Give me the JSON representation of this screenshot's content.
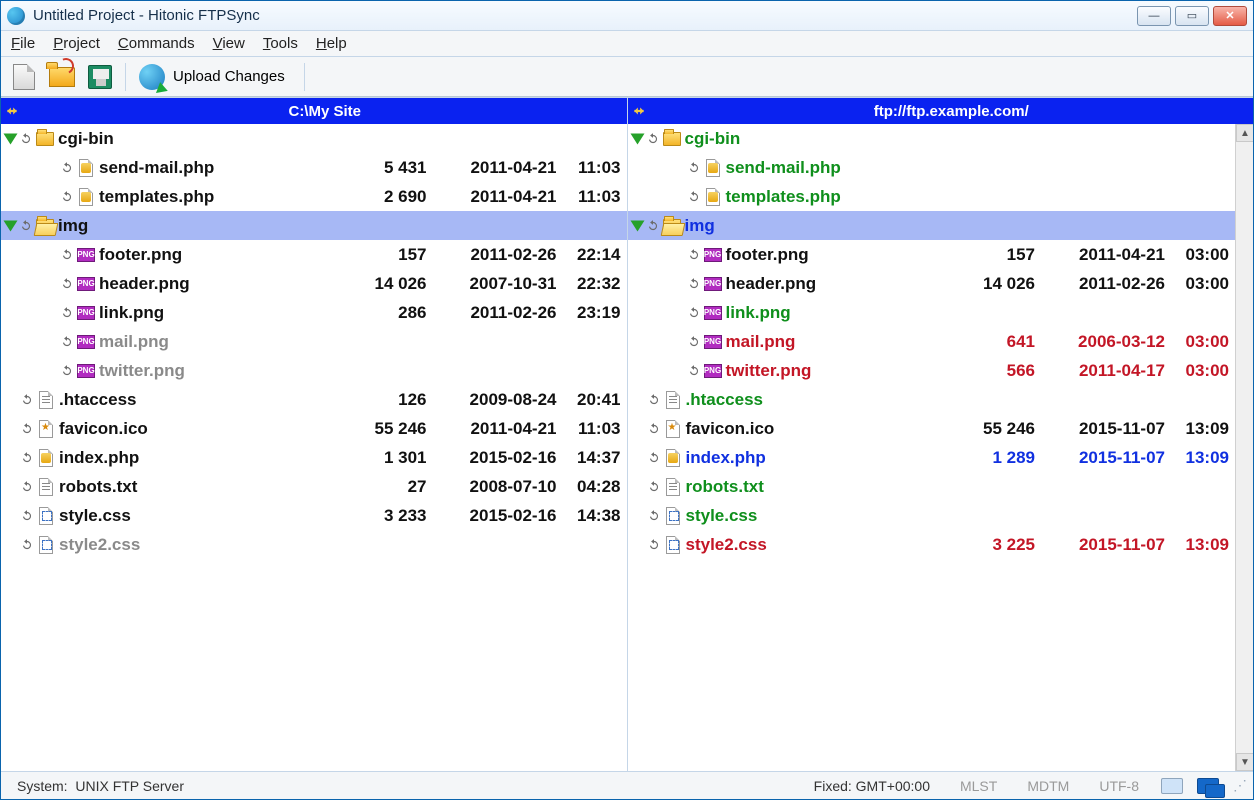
{
  "title": "Untitled Project - Hitonic FTPSync",
  "menu": [
    "File",
    "Project",
    "Commands",
    "View",
    "Tools",
    "Help"
  ],
  "toolbar": {
    "upload": "Upload Changes"
  },
  "left": {
    "path": "C:\\My Site",
    "rows": [
      {
        "type": "dir",
        "depth": 0,
        "expanded": true,
        "icon": "folder",
        "name": "cgi-bin",
        "dir": "<DIR>",
        "color": "black",
        "open": false
      },
      {
        "type": "file",
        "depth": 1,
        "icon": "php",
        "name": "send-mail.php",
        "size": "5 431",
        "date": "2011-04-21",
        "time": "11:03",
        "color": "black"
      },
      {
        "type": "file",
        "depth": 1,
        "icon": "php",
        "name": "templates.php",
        "size": "2 690",
        "date": "2011-04-21",
        "time": "11:03",
        "color": "black"
      },
      {
        "type": "dir",
        "depth": 0,
        "expanded": true,
        "icon": "folder-open",
        "name": "img",
        "dir": "<DIR>",
        "color": "black",
        "open": true,
        "selected": true
      },
      {
        "type": "file",
        "depth": 1,
        "icon": "png",
        "name": "footer.png",
        "size": "157",
        "date": "2011-02-26",
        "time": "22:14",
        "color": "black"
      },
      {
        "type": "file",
        "depth": 1,
        "icon": "png",
        "name": "header.png",
        "size": "14 026",
        "date": "2007-10-31",
        "time": "22:32",
        "color": "black"
      },
      {
        "type": "file",
        "depth": 1,
        "icon": "png",
        "name": "link.png",
        "size": "286",
        "date": "2011-02-26",
        "time": "23:19",
        "color": "black"
      },
      {
        "type": "file",
        "depth": 1,
        "icon": "png",
        "name": "mail.png",
        "size": "",
        "date": "",
        "time": "",
        "color": "gray"
      },
      {
        "type": "file",
        "depth": 1,
        "icon": "png",
        "name": "twitter.png",
        "size": "",
        "date": "",
        "time": "",
        "color": "gray"
      },
      {
        "type": "file",
        "depth": 0,
        "icon": "txt",
        "name": ".htaccess",
        "size": "126",
        "date": "2009-08-24",
        "time": "20:41",
        "color": "black"
      },
      {
        "type": "file",
        "depth": 0,
        "icon": "ico",
        "name": "favicon.ico",
        "size": "55 246",
        "date": "2011-04-21",
        "time": "11:03",
        "color": "black"
      },
      {
        "type": "file",
        "depth": 0,
        "icon": "php",
        "name": "index.php",
        "size": "1 301",
        "date": "2015-02-16",
        "time": "14:37",
        "color": "black"
      },
      {
        "type": "file",
        "depth": 0,
        "icon": "txt",
        "name": "robots.txt",
        "size": "27",
        "date": "2008-07-10",
        "time": "04:28",
        "color": "black"
      },
      {
        "type": "file",
        "depth": 0,
        "icon": "css",
        "name": "style.css",
        "size": "3 233",
        "date": "2015-02-16",
        "time": "14:38",
        "color": "black"
      },
      {
        "type": "file",
        "depth": 0,
        "icon": "css",
        "name": "style2.css",
        "size": "",
        "date": "",
        "time": "",
        "color": "gray"
      }
    ]
  },
  "right": {
    "path": "ftp://ftp.example.com/",
    "rows": [
      {
        "type": "dir",
        "depth": 0,
        "expanded": true,
        "icon": "folder",
        "name": "cgi-bin",
        "dir": "<DIR>",
        "color": "green",
        "open": false
      },
      {
        "type": "file",
        "depth": 1,
        "icon": "php",
        "name": "send-mail.php",
        "size": "",
        "date": "",
        "time": "",
        "color": "green"
      },
      {
        "type": "file",
        "depth": 1,
        "icon": "php",
        "name": "templates.php",
        "size": "",
        "date": "",
        "time": "",
        "color": "green"
      },
      {
        "type": "dir",
        "depth": 0,
        "expanded": true,
        "icon": "folder-open",
        "name": "img",
        "dir": "<DIR>",
        "color": "blue",
        "open": true,
        "selected": true
      },
      {
        "type": "file",
        "depth": 1,
        "icon": "png",
        "name": "footer.png",
        "size": "157",
        "date": "2011-04-21",
        "time": "03:00",
        "color": "black"
      },
      {
        "type": "file",
        "depth": 1,
        "icon": "png",
        "name": "header.png",
        "size": "14 026",
        "date": "2011-02-26",
        "time": "03:00",
        "color": "black"
      },
      {
        "type": "file",
        "depth": 1,
        "icon": "png",
        "name": "link.png",
        "size": "",
        "date": "",
        "time": "",
        "color": "green"
      },
      {
        "type": "file",
        "depth": 1,
        "icon": "png",
        "name": "mail.png",
        "size": "641",
        "date": "2006-03-12",
        "time": "03:00",
        "color": "red"
      },
      {
        "type": "file",
        "depth": 1,
        "icon": "png",
        "name": "twitter.png",
        "size": "566",
        "date": "2011-04-17",
        "time": "03:00",
        "color": "red"
      },
      {
        "type": "file",
        "depth": 0,
        "icon": "txt",
        "name": ".htaccess",
        "size": "",
        "date": "",
        "time": "",
        "color": "green"
      },
      {
        "type": "file",
        "depth": 0,
        "icon": "ico",
        "name": "favicon.ico",
        "size": "55 246",
        "date": "2015-11-07",
        "time": "13:09",
        "color": "black"
      },
      {
        "type": "file",
        "depth": 0,
        "icon": "php",
        "name": "index.php",
        "size": "1 289",
        "date": "2015-11-07",
        "time": "13:09",
        "color": "blue"
      },
      {
        "type": "file",
        "depth": 0,
        "icon": "txt",
        "name": "robots.txt",
        "size": "",
        "date": "",
        "time": "",
        "color": "green"
      },
      {
        "type": "file",
        "depth": 0,
        "icon": "css",
        "name": "style.css",
        "size": "",
        "date": "",
        "time": "",
        "color": "green"
      },
      {
        "type": "file",
        "depth": 0,
        "icon": "css",
        "name": "style2.css",
        "size": "3 225",
        "date": "2015-11-07",
        "time": "13:09",
        "color": "red"
      }
    ]
  },
  "status": {
    "system_label": "System:",
    "system_value": "UNIX FTP Server",
    "tz": "Fixed: GMT+00:00",
    "flags": [
      "MLST",
      "MDTM",
      "UTF-8"
    ]
  }
}
